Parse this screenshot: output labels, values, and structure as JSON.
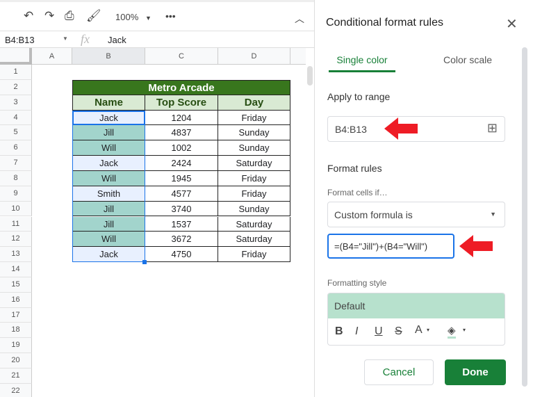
{
  "toolbar": {
    "zoom": "100%",
    "icons": [
      "undo-icon",
      "redo-icon",
      "print-icon",
      "paint-format-icon",
      "more-icon",
      "collapse-icon"
    ]
  },
  "formula_bar": {
    "name_box": "B4:B13",
    "fx": "fx",
    "value": "Jack"
  },
  "columns": [
    "A",
    "B",
    "C",
    "D"
  ],
  "rows": [
    "1",
    "2",
    "3",
    "4",
    "5",
    "6",
    "7",
    "8",
    "9",
    "10",
    "11",
    "12",
    "13",
    "14",
    "15",
    "16",
    "17",
    "18",
    "19",
    "20",
    "21",
    "22"
  ],
  "table": {
    "title": "Metro Arcade",
    "headers": [
      "Name",
      "Top Score",
      "Day"
    ],
    "data": [
      [
        "Jack",
        "1204",
        "Friday"
      ],
      [
        "Jill",
        "4837",
        "Sunday"
      ],
      [
        "Will",
        "1002",
        "Sunday"
      ],
      [
        "Jack",
        "2424",
        "Saturday"
      ],
      [
        "Will",
        "1945",
        "Friday"
      ],
      [
        "Smith",
        "4577",
        "Friday"
      ],
      [
        "Jill",
        "3740",
        "Sunday"
      ],
      [
        "Jill",
        "1537",
        "Saturday"
      ],
      [
        "Will",
        "3672",
        "Saturday"
      ],
      [
        "Jack",
        "4750",
        "Friday"
      ]
    ]
  },
  "colors": {
    "title_bg": "#38761d",
    "header_bg": "#d9ead3",
    "highlight": "#a2d4cc",
    "selection": "#e8f0fe",
    "accent": "#188038"
  },
  "panel": {
    "title": "Conditional format rules",
    "tabs": [
      "Single color",
      "Color scale"
    ],
    "apply_label": "Apply to range",
    "range": "B4:B13",
    "format_rules": "Format rules",
    "format_cells_if": "Format cells if…",
    "condition": "Custom formula is",
    "formula": "=(B4=\"Jill\")+(B4=\"Will\")",
    "formatting_style": "Formatting style",
    "style_preview": "Default",
    "style_buttons": [
      "B",
      "I",
      "U",
      "S",
      "A"
    ],
    "cancel": "Cancel",
    "done": "Done"
  }
}
